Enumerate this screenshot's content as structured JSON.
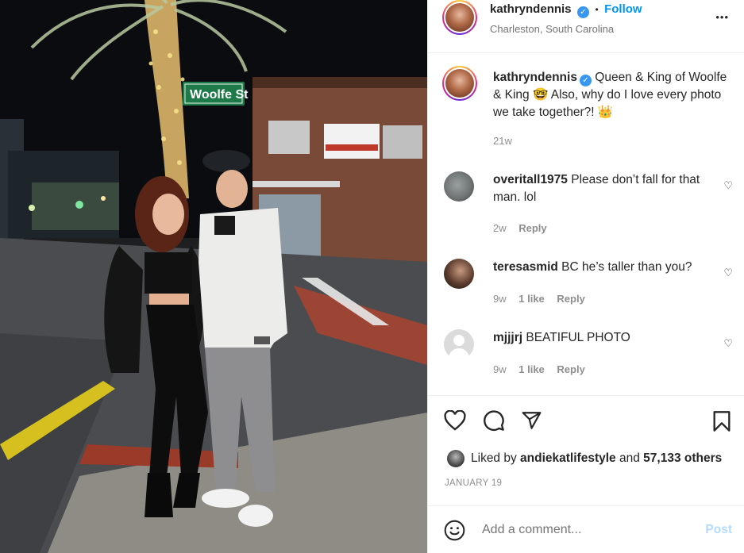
{
  "post": {
    "username": "kathryndennis",
    "follow_label": "Follow",
    "separator": "•",
    "location": "Charleston, South Carolina",
    "more_label": "•••",
    "street_sign": "Woolfe St",
    "caption": {
      "username": "kathryndennis",
      "text_part1": "Queen & King of Woolfe & King ",
      "emoji1": "🤓",
      "text_part2": " Also, why do I love every photo we take together?! ",
      "emoji2": "👑",
      "time": "21w"
    }
  },
  "comments": [
    {
      "username": "overitall1975",
      "text": "Please don’t fall for that man. lol",
      "time": "2w",
      "likes": "",
      "reply": "Reply"
    },
    {
      "username": "teresasmid",
      "text": "BC he’s taller than you?",
      "time": "9w",
      "likes": "1 like",
      "reply": "Reply"
    },
    {
      "username": "mjjjrj",
      "text": "BEATIFUL PHOTO",
      "time": "9w",
      "likes": "1 like",
      "reply": "Reply"
    }
  ],
  "likes": {
    "prefix": "Liked by",
    "liker": "andiekatlifestyle",
    "middle": "and",
    "count": "57,133 others"
  },
  "date": "JANUARY 19",
  "add_comment": {
    "placeholder": "Add a comment...",
    "post_label": "Post"
  },
  "colors": {
    "accent": "#0095f6",
    "post_disabled": "#b3dbff",
    "verified": "#3897f0",
    "text": "#262626",
    "muted": "#8e8e8e"
  },
  "icons": [
    "verified-badge-icon",
    "more-options-icon",
    "heart-icon",
    "comment-icon",
    "share-icon",
    "save-icon",
    "emoji-icon"
  ]
}
